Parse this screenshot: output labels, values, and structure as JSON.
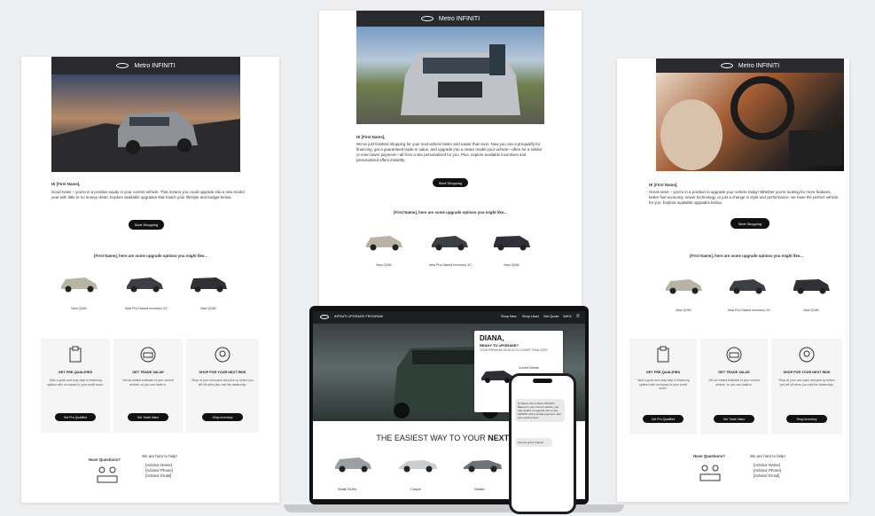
{
  "brand": "Metro INFINITI",
  "left_email": {
    "greeting": "Hi [First Name],",
    "body": "Good news – you're in a positive equity in your current vehicle. That means you could upgrade into a new model year with little to no money down. Explore available upgrades that match your lifestyle and budget below.",
    "cta": "Start Shopping",
    "options_heading": "[First Name], here are some upgrade options you might like...",
    "cars": [
      "New QX60",
      "New Pre-Owned Inventory XC",
      "New QX80"
    ],
    "cards": [
      {
        "title": "GET PRE-QUALIFIED",
        "desc": "Take a quick and easy step to financing options with no impact to your credit score.",
        "btn": "Get Pre-Qualified"
      },
      {
        "title": "GET TRADE VALUE",
        "desc": "Get an instant estimate of your current vehicle, so you can trade in.",
        "btn": "Get Trade Value"
      },
      {
        "title": "SHOP FOR YOUR NEXT RIDE",
        "desc": "Shop at your own pace and pick up where you left off when you visit the dealership.",
        "btn": "Shop Inventory"
      }
    ],
    "questions_label": "Have Questions?",
    "contact_label": "We are here to help!",
    "contact_lines": [
      "[Advisor Name]",
      "[Advisor Phone]",
      "[Advisor Email]"
    ]
  },
  "center_email": {
    "greeting": "Hi [First Name],",
    "body": "We've just finished shopping for your next vehicle faster and easier than ever. Now you can a prequalify for financing, get a guaranteed trade-in value, and upgrade into a newer model your vehicle—often for a similar or even lower payment—all from a site personalized for you. Plus, explore available incentives and personalized offers instantly.",
    "cta": "Start Shopping",
    "options_heading": "[First Name], here are some upgrade options you might like...",
    "cars": [
      "New QX60",
      "New Pre-Owned Inventory XC",
      "New QX80"
    ]
  },
  "right_email": {
    "greeting": "Hi [First Name],",
    "body": "Great news – you're in a position to upgrade your vehicle today! Whether you're looking for more features, better fuel economy, newer technology, or just a change in style and performance, we have the perfect vehicle for you. Explore available upgrades below.",
    "cta": "Start Shopping",
    "options_heading": "[First Name], here are some upgrade options you might like...",
    "cars": [
      "New QX60",
      "New Pre-Owned Inventory XC",
      "New QX80"
    ],
    "cards": [
      {
        "title": "GET PRE-QUALIFIED",
        "desc": "Take a quick and easy step to financing options with no impact to your credit score.",
        "btn": "Get Pre-Qualified"
      },
      {
        "title": "GET TRADE VALUE",
        "desc": "Get an instant estimate of your current vehicle, so you can trade in.",
        "btn": "Get Trade Value"
      },
      {
        "title": "SHOP FOR YOUR NEXT RIDE",
        "desc": "Shop at your own pace and pick up where you left off when you visit the dealership.",
        "btn": "Shop Inventory"
      }
    ],
    "questions_label": "Have Questions?",
    "contact_label": "We are here to help!",
    "contact_lines": [
      "[Advisor Name]",
      "[Advisor Phone]",
      "[Advisor Email]"
    ]
  },
  "laptop": {
    "site_title": "INFINITI UPGRADE PROGRAM",
    "nav": [
      "Shop New",
      "Shop Used",
      "Get Quote",
      "Sell It"
    ],
    "overlay_name": "DIANA,",
    "overlay_line1": "READY TO UPGRADE?",
    "overlay_line2": "YOUR PREMIUM VEHICLE IS CLOSER THAN EVER",
    "overlay_vehicle_label": "Current Vehicle",
    "headline_prefix": "THE EASIEST WAY TO YOUR ",
    "headline_accent": "NEXT VE",
    "categories": [
      "Small SUVs",
      "Coupe",
      "Sedan"
    ]
  },
  "phone": {
    "message": "Hi Diana, this is Metro INFINITI. Based on your current vehicle, you may qualify to upgrade into a new INFINITI with a similar payment. See your options here.",
    "reply": "Sounds good, thanks!"
  }
}
